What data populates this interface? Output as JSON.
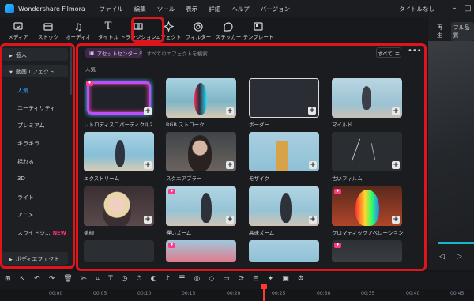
{
  "app": {
    "name": "Wondershare Filmora",
    "project_title": "タイトルなし"
  },
  "menu": [
    "ファイル",
    "編集",
    "ツール",
    "表示",
    "詳細",
    "ヘルプ",
    "バージョン"
  ],
  "toolbar": [
    {
      "label": "メディア",
      "icon": "media-icon"
    },
    {
      "label": "ストック",
      "icon": "stock-icon"
    },
    {
      "label": "オーディオ",
      "icon": "music-icon"
    },
    {
      "label": "タイトル",
      "icon": "title-icon"
    },
    {
      "label": "トランジション",
      "icon": "transition-icon"
    },
    {
      "label": "エフェクト",
      "icon": "effects-icon",
      "active": true
    },
    {
      "label": "フィルター",
      "icon": "filter-icon"
    },
    {
      "label": "ステッカー",
      "icon": "sticker-icon"
    },
    {
      "label": "テンプレート",
      "icon": "template-icon"
    }
  ],
  "right_panel": {
    "tabs": [
      "再生",
      "フル品質"
    ]
  },
  "sidebar": {
    "categories": [
      {
        "label": "個人"
      },
      {
        "label": "動画エフェクト"
      }
    ],
    "sub_items": [
      "人気",
      "ユーティリティ",
      "プレミアム",
      "キラキラ",
      "揺れる",
      "3D",
      "ライト",
      "アニメ",
      "スライドシ..."
    ],
    "selected": "人気",
    "new_badge": "NEW",
    "partial_item": "ボディエフェクト"
  },
  "main": {
    "asset_center": "アセットセンター",
    "search_placeholder": "すべてのエフェクトを検索",
    "filter": "すべて",
    "section": "人気",
    "cards": [
      "レトロディスコパーティクル2",
      "RGB ストローク",
      "ボーダー",
      "マイルド",
      "エクストリーム",
      "スクエアブラー",
      "モザイク",
      "古いフィルム",
      "美顔",
      "遅いズーム",
      "高速ズーム",
      "クロマティックアベレーション"
    ]
  },
  "timeline": {
    "ticks": [
      "00:00",
      "00:05",
      "00:10",
      "00:15",
      "00:20",
      "00:25",
      "00:30",
      "00:35",
      "00:40",
      "00:45"
    ]
  },
  "colors": {
    "highlight_red": "#e0151c",
    "accent_blue": "#3aa7ff",
    "premium_pink": "#ff3a8a"
  }
}
